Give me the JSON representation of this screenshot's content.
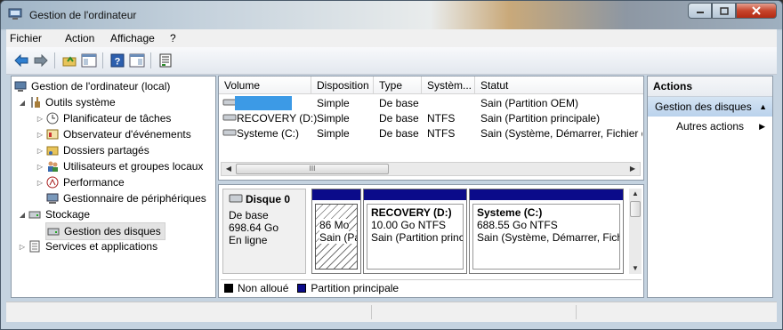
{
  "window": {
    "title": "Gestion de l'ordinateur"
  },
  "menu": [
    "Fichier",
    "Action",
    "Affichage",
    "?"
  ],
  "tree": {
    "root": "Gestion de l'ordinateur (local)",
    "system_tools": "Outils système",
    "task_scheduler": "Planificateur de tâches",
    "event_viewer": "Observateur d'événements",
    "shared_folders": "Dossiers partagés",
    "users_groups": "Utilisateurs et groupes locaux",
    "performance": "Performance",
    "device_manager": "Gestionnaire de périphériques",
    "storage": "Stockage",
    "disk_management": "Gestion des disques",
    "services_apps": "Services et applications"
  },
  "volumes": {
    "columns": [
      "Volume",
      "Disposition",
      "Type",
      "Systèm...",
      "Statut"
    ],
    "rows": [
      {
        "volume": "",
        "layout": "Simple",
        "type": "De base",
        "fs": "",
        "status": "Sain (Partition OEM)"
      },
      {
        "volume": "RECOVERY (D:)",
        "layout": "Simple",
        "type": "De base",
        "fs": "NTFS",
        "status": "Sain (Partition principale)"
      },
      {
        "volume": "Systeme (C:)",
        "layout": "Simple",
        "type": "De base",
        "fs": "NTFS",
        "status": "Sain (Système, Démarrer, Fichier d'"
      }
    ],
    "scroll_grip": "III"
  },
  "disk": {
    "name": "Disque 0",
    "type": "De base",
    "size": "698.64 Go",
    "state": "En ligne",
    "partitions": [
      {
        "line1": "86 Mo",
        "line2": "Sain (Pa"
      },
      {
        "name": "RECOVERY  (D:)",
        "size": "10.00 Go NTFS",
        "status": "Sain (Partition princ"
      },
      {
        "name": "Systeme  (C:)",
        "size": "688.55 Go NTFS",
        "status": "Sain (Système, Démarrer, Fichi"
      }
    ]
  },
  "legend": {
    "unallocated": "Non alloué",
    "primary": "Partition principale"
  },
  "actions": {
    "header": "Actions",
    "selected": "Gestion des disques",
    "more": "Autres actions"
  },
  "colors": {
    "partition_head": "#0b0b8a",
    "selection": "#bad2ec",
    "highlight_volume": "#3c9ae6"
  }
}
